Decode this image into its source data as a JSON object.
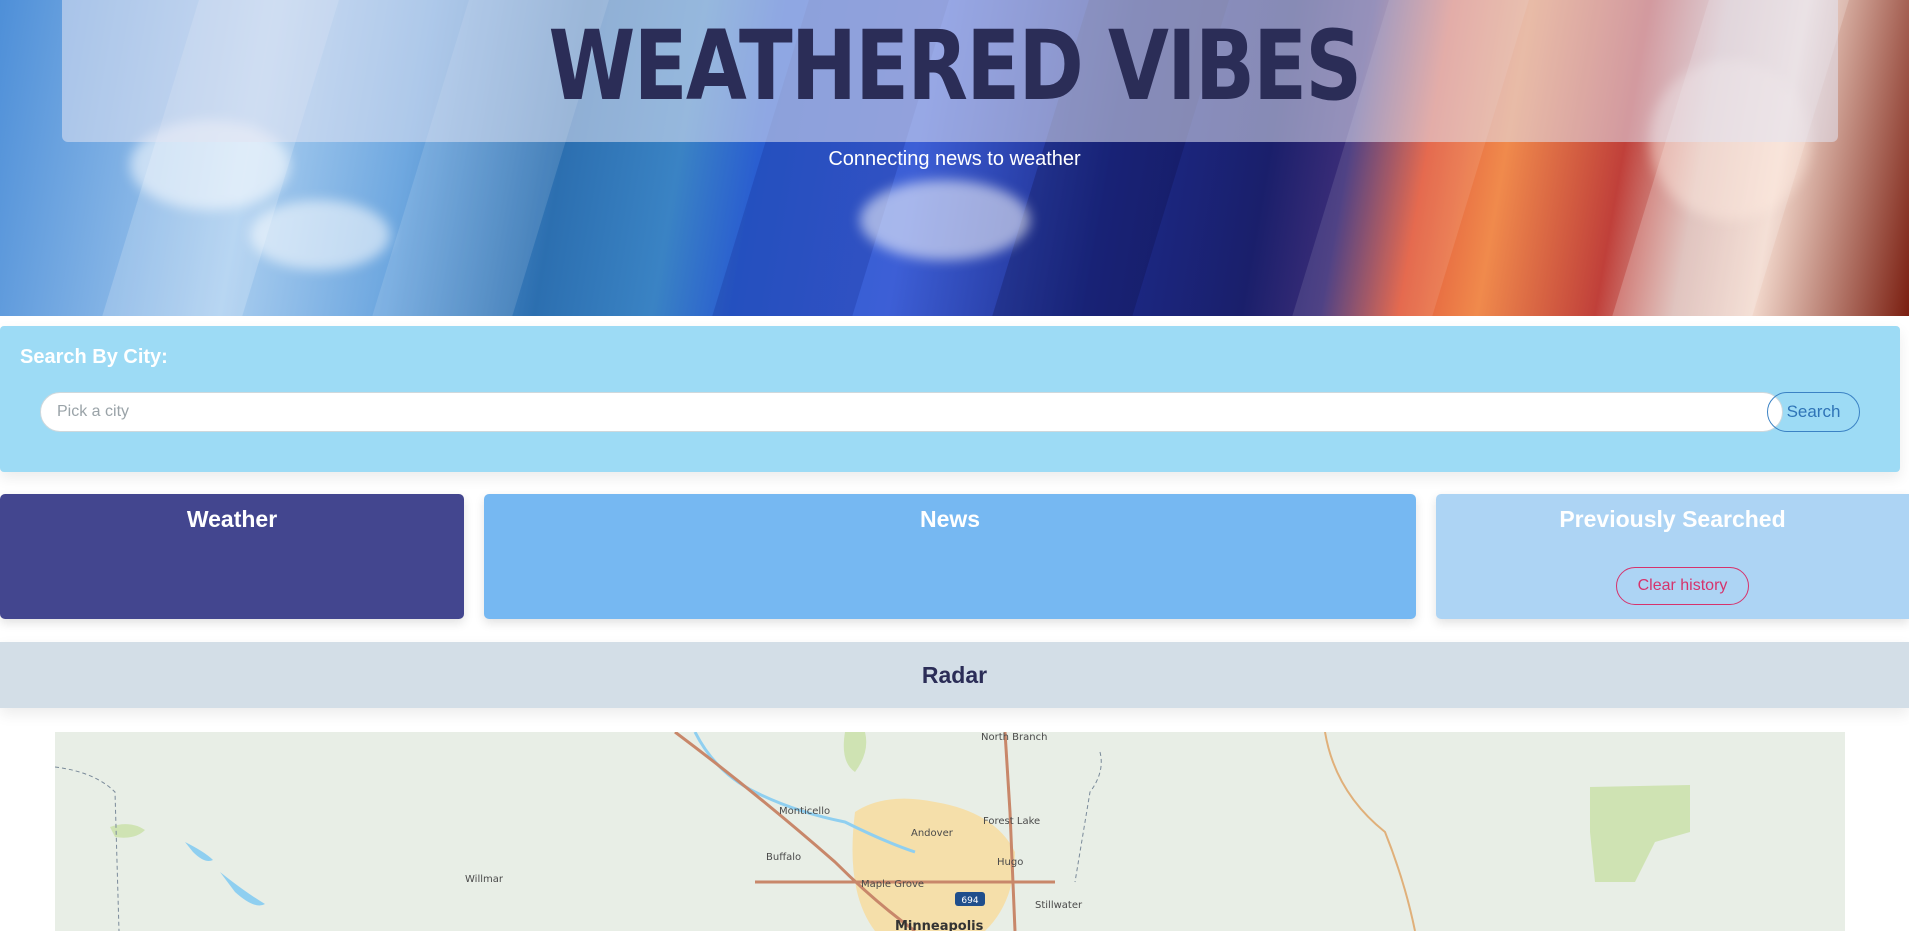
{
  "hero": {
    "title": "WEATHERED VIBES",
    "subtitle": "Connecting news to weather"
  },
  "search": {
    "label": "Search By City:",
    "placeholder": "Pick a city",
    "button_label": "Search"
  },
  "cards": {
    "weather_title": "Weather",
    "news_title": "News",
    "history_title": "Previously Searched",
    "clear_label": "Clear history"
  },
  "radar": {
    "title": "Radar"
  },
  "map": {
    "places": [
      "North Branch",
      "Monticello",
      "Forest Lake",
      "Andover",
      "Buffalo",
      "Hugo",
      "Willmar",
      "Maple Grove",
      "Stillwater",
      "Minneapolis"
    ],
    "highway_shield": "694"
  },
  "colors": {
    "accent_dark": "#2b2d57",
    "search_panel": "#9ddbf5",
    "weather_card": "#43468f",
    "news_card": "#76b8f2",
    "history_card": "#add4f4",
    "danger": "#d6336c"
  },
  "icons": {
    "highway_shield": "interstate-shield-icon"
  }
}
